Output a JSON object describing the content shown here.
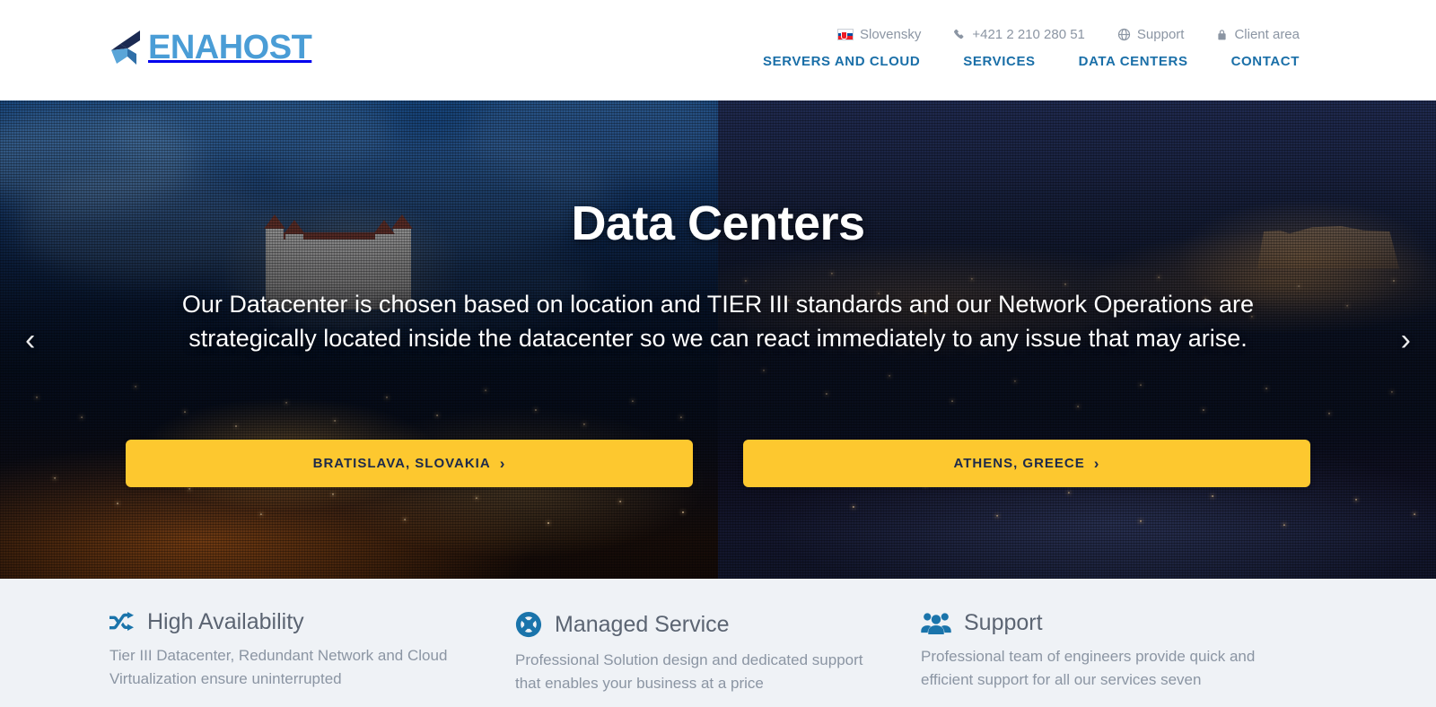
{
  "brand": {
    "logo_text": "ENAHOST",
    "logo_icon": "enahost-mark-icon",
    "accent_blue": "#4a9dd6",
    "nav_blue": "#1a6fa8",
    "cta_yellow": "#fdc82f",
    "cta_text_color": "#1d2a4a"
  },
  "header": {
    "utility": [
      {
        "label": "Slovensky",
        "icon": "slovak-flag-icon"
      },
      {
        "label": "+421 2 210 280 51",
        "icon": "phone-icon"
      },
      {
        "label": "Support",
        "icon": "globe-icon"
      },
      {
        "label": "Client area",
        "icon": "lock-icon"
      }
    ],
    "nav": [
      {
        "label": "SERVERS AND CLOUD"
      },
      {
        "label": "SERVICES"
      },
      {
        "label": "DATA CENTERS"
      },
      {
        "label": "CONTACT"
      }
    ]
  },
  "hero": {
    "title": "Data Centers",
    "subtitle": "Our Datacenter is chosen based on location and TIER III standards and our Network Operations are strategically located inside the datacenter so we can react immediately to any issue that may arise.",
    "prev_arrow": "‹",
    "next_arrow": "›",
    "buttons": [
      {
        "label": "BRATISLAVA, SLOVAKIA",
        "chevron": "›"
      },
      {
        "label": "ATHENS, GREECE",
        "chevron": "›"
      }
    ]
  },
  "features": [
    {
      "icon": "shuffle-icon",
      "title": "High Availability",
      "text": "Tier III Datacenter, Redundant Network and Cloud Virtualization ensure uninterrupted"
    },
    {
      "icon": "lifebuoy-icon",
      "title": "Managed Service",
      "text": "Professional Solution design and dedicated support that enables your business at a price"
    },
    {
      "icon": "people-group-icon",
      "title": "Support",
      "text": "Professional team of engineers provide quick and efficient support for all our services seven"
    }
  ]
}
